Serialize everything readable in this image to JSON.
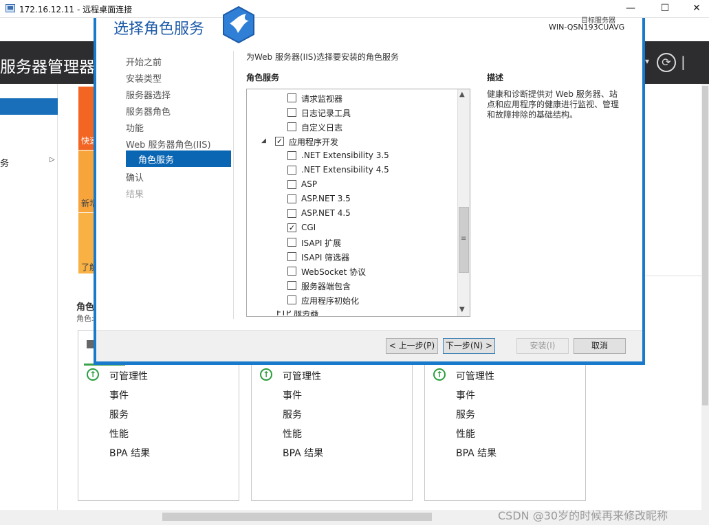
{
  "rdp": {
    "title": "172.16.12.11 - 远程桌面连接",
    "minimize": "—",
    "maximize": "☐",
    "close": "✕"
  },
  "server_manager": {
    "title": "服务器管理器",
    "header_caret": "▾",
    "header_pipe": "|",
    "refresh_icon": "⟳",
    "left_item": "务",
    "left_arrow": "▷",
    "tiles": [
      "快速",
      "新增",
      "了解"
    ],
    "roles_title": "角色",
    "roles_subtitle": "角色:",
    "cards": [
      {
        "status_icon": "↑",
        "rows": [
          "可管理性",
          "事件",
          "服务",
          "性能",
          "BPA 结果"
        ]
      },
      {
        "status_icon": "↑",
        "rows": [
          "可管理性",
          "事件",
          "服务",
          "性能",
          "BPA 结果"
        ]
      },
      {
        "status_icon": "↑",
        "rows": [
          "可管理性",
          "事件",
          "服务",
          "性能",
          "BPA 结果"
        ]
      }
    ]
  },
  "wizard": {
    "title": "选择角色服务",
    "server_label": "目标服务器",
    "server_name": "WIN-QSN193CUAVG",
    "nav": [
      {
        "label": "开始之前",
        "state": "normal"
      },
      {
        "label": "安装类型",
        "state": "normal"
      },
      {
        "label": "服务器选择",
        "state": "normal"
      },
      {
        "label": "服务器角色",
        "state": "normal"
      },
      {
        "label": "功能",
        "state": "normal"
      },
      {
        "label": "Web 服务器角色(IIS)",
        "state": "normal"
      },
      {
        "label": "角色服务",
        "state": "selected"
      },
      {
        "label": "确认",
        "state": "normal"
      },
      {
        "label": "结果",
        "state": "disabled"
      }
    ],
    "heading": "为Web 服务器(IIS)选择要安装的角色服务",
    "role_services_label": "角色服务",
    "description_label": "描述",
    "description_text": "健康和诊断提供对 Web 服务器、站点和应用程序的健康进行监视、管理和故障排除的基础结构。",
    "tree": [
      {
        "label": "请求监视器",
        "checked": false,
        "level": 2
      },
      {
        "label": "日志记录工具",
        "checked": false,
        "level": 2
      },
      {
        "label": "自定义日志",
        "checked": false,
        "level": 2
      },
      {
        "label": "应用程序开发",
        "checked": true,
        "level": 1
      },
      {
        "label": ".NET Extensibility 3.5",
        "checked": false,
        "level": 2
      },
      {
        "label": ".NET Extensibility 4.5",
        "checked": false,
        "level": 2
      },
      {
        "label": "ASP",
        "checked": false,
        "level": 2
      },
      {
        "label": "ASP.NET 3.5",
        "checked": false,
        "level": 2
      },
      {
        "label": "ASP.NET 4.5",
        "checked": false,
        "level": 2
      },
      {
        "label": "CGI",
        "checked": true,
        "level": 2
      },
      {
        "label": "ISAPI 扩展",
        "checked": false,
        "level": 2
      },
      {
        "label": "ISAPI 筛选器",
        "checked": false,
        "level": 2
      },
      {
        "label": "WebSocket 协议",
        "checked": false,
        "level": 2
      },
      {
        "label": "服务器端包含",
        "checked": false,
        "level": 2
      },
      {
        "label": "应用程序初始化",
        "checked": false,
        "level": 2
      },
      {
        "label": "FTP 服务器",
        "checked": false,
        "level": 1
      }
    ],
    "tree_expander": "◢",
    "scroll_up": "▲",
    "scroll_down": "▼",
    "scroll_grip": "≡",
    "buttons": {
      "prev": "< 上一步(P)",
      "next": "下一步(N) >",
      "install": "安装(I)",
      "cancel": "取消"
    }
  },
  "watermark": "CSDN @30岁的时候再来修改昵称"
}
